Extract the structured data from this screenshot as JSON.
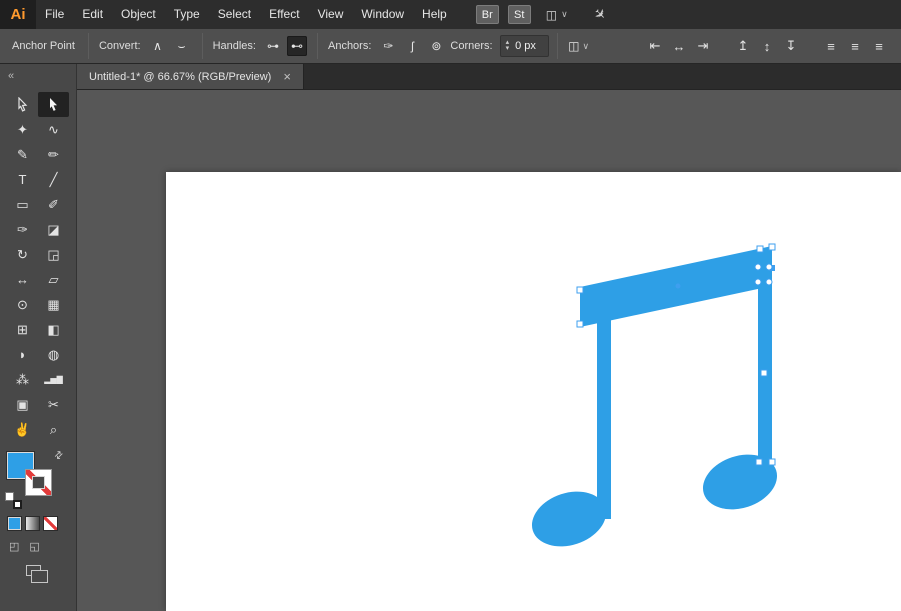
{
  "menubar": {
    "logo": "Ai",
    "items": [
      "File",
      "Edit",
      "Object",
      "Type",
      "Select",
      "Effect",
      "View",
      "Window",
      "Help"
    ],
    "bridge": "Br",
    "stock": "St",
    "icons": {
      "workspace": "◫",
      "chevron": "∨",
      "gpu": "✈"
    }
  },
  "controlbar": {
    "context": "Anchor Point",
    "convert_label": "Convert:",
    "handles_label": "Handles:",
    "anchors_label": "Anchors:",
    "corners_label": "Corners:",
    "corners_value": "0 px",
    "icons": {
      "convert_corner": "∧",
      "convert_smooth": "⌣",
      "handles_show": "⊶",
      "handles_hide": "⊷",
      "anchor_cut": "✑",
      "anchor_connect": "ʃ",
      "globe": "⊚",
      "transform": "◫",
      "chevron": "∨",
      "step_up": "▴",
      "step_down": "▾"
    },
    "align": [
      "⇤",
      "↔",
      "⇥",
      "↥",
      "↕",
      "↧",
      "≡",
      "≡",
      "≡"
    ]
  },
  "tab": {
    "title": "Untitled-1* @ 66.67% (RGB/Preview)",
    "close": "×"
  },
  "toolpanel": {
    "collapse": "«",
    "tools": [
      {
        "name": "selection",
        "glyph": ""
      },
      {
        "name": "direct-selection",
        "glyph": "",
        "selected": true
      },
      {
        "name": "magic-wand",
        "glyph": "✦"
      },
      {
        "name": "lasso",
        "glyph": "∿"
      },
      {
        "name": "pen",
        "glyph": "✎"
      },
      {
        "name": "curvature",
        "glyph": "✏"
      },
      {
        "name": "type",
        "glyph": "T"
      },
      {
        "name": "line-segment",
        "glyph": "╱"
      },
      {
        "name": "rectangle",
        "glyph": "▭"
      },
      {
        "name": "paintbrush",
        "glyph": "✐"
      },
      {
        "name": "shaper",
        "glyph": "✑"
      },
      {
        "name": "eraser",
        "glyph": "◪"
      },
      {
        "name": "rotate",
        "glyph": "↻"
      },
      {
        "name": "scale",
        "glyph": "◲"
      },
      {
        "name": "width",
        "glyph": "↔"
      },
      {
        "name": "free-transform",
        "glyph": "▱"
      },
      {
        "name": "shape-builder",
        "glyph": "⊙"
      },
      {
        "name": "perspective-grid",
        "glyph": "▦"
      },
      {
        "name": "mesh",
        "glyph": "⊞"
      },
      {
        "name": "gradient",
        "glyph": "◧"
      },
      {
        "name": "eyedropper",
        "glyph": "◗"
      },
      {
        "name": "blend",
        "glyph": "◍"
      },
      {
        "name": "symbol-sprayer",
        "glyph": "⁂"
      },
      {
        "name": "column-graph",
        "glyph": "▂▅▇"
      },
      {
        "name": "artboard",
        "glyph": "▣"
      },
      {
        "name": "slice",
        "glyph": "✂"
      },
      {
        "name": "hand",
        "glyph": "✌"
      },
      {
        "name": "zoom",
        "glyph": "⌕"
      }
    ]
  },
  "colors": {
    "note": "#2E9FE6",
    "selection": "#3E9FEF",
    "fill_swatch": "#2E9FE6",
    "stroke_none_slash": "#E23B3B"
  }
}
